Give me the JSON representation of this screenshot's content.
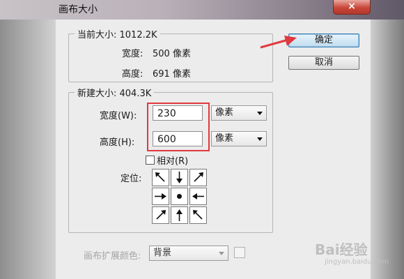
{
  "window": {
    "title": "画布大小",
    "close_symbol": "×"
  },
  "current_size": {
    "legend": "当前大小: 1012.2K",
    "width_label": "宽度:",
    "width_value": "500 像素",
    "height_label": "高度:",
    "height_value": "691 像素"
  },
  "buttons": {
    "ok": "确定",
    "cancel": "取消"
  },
  "new_size": {
    "legend": "新建大小: 404.3K",
    "width_label": "宽度(W):",
    "width_value": "230",
    "width_unit": "像素",
    "height_label": "高度(H):",
    "height_value": "600",
    "height_unit": "像素",
    "relative_label": "相对(R)",
    "relative_checked": false,
    "anchor_label": "定位:"
  },
  "canvas_ext": {
    "label": "画布扩展颜色:",
    "value": "背景"
  },
  "watermark": {
    "text": "Bai经验",
    "sub": "jingyan.baidu.com"
  },
  "colors": {
    "annotation_red": "#e0393e"
  },
  "icons": [
    "close-icon",
    "dropdown-arrow-icon",
    "anchor-arrow-icon",
    "anchor-center-dot-icon",
    "annotation-arrow-icon"
  ]
}
